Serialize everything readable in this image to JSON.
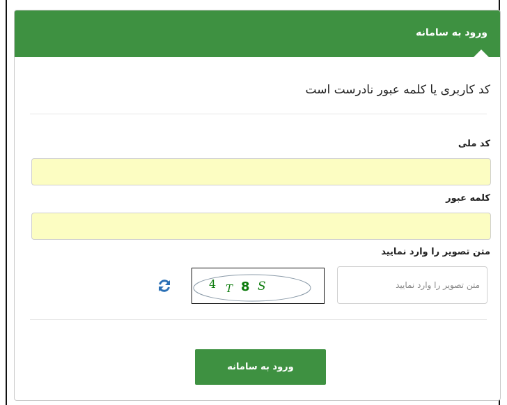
{
  "panel": {
    "title": "ورود به سامانه"
  },
  "error": {
    "message": "کد کاربری یا کلمه عبور نادرست است"
  },
  "fields": {
    "national_code": {
      "label": "کد ملی",
      "value": ""
    },
    "password": {
      "label": "کلمه عبور",
      "value": ""
    },
    "captcha": {
      "label": "متن تصویر را وارد نمایید",
      "placeholder": "متن تصویر را وارد نمایید",
      "image_chars": [
        "4",
        "T",
        "8",
        "S"
      ]
    }
  },
  "buttons": {
    "submit_label": "ورود به سامانه"
  },
  "icons": {
    "refresh": "refresh-icon"
  },
  "colors": {
    "brand_green": "#3e9141",
    "field_fill": "#fcfdc2",
    "captcha_text": "#0a7a0a",
    "refresh_blue": "#2a6fb5"
  }
}
